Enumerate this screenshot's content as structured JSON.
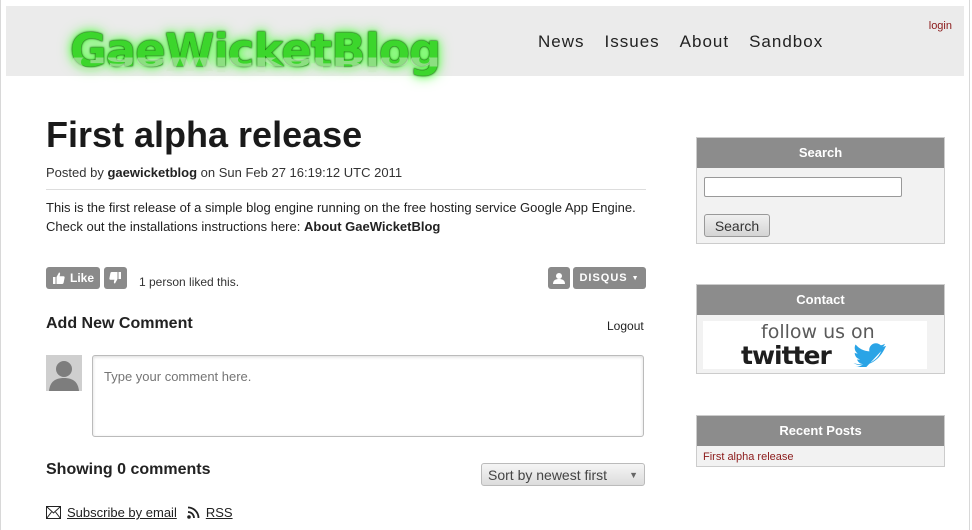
{
  "header": {
    "login": "login",
    "logo": "GaeWicketBlog",
    "nav": [
      "News",
      "Issues",
      "About",
      "Sandbox"
    ]
  },
  "post": {
    "title": "First alpha release",
    "posted_by_prefix": "Posted by",
    "author": "gaewicketblog",
    "date_text": "on Sun Feb 27 16:19:12 UTC 2011",
    "body_line1": "This is the first release of a simple blog engine running on the free hosting service Google App Engine.",
    "body_line2_prefix": "Check out the installations instructions here:",
    "body_link": "About GaeWicketBlog"
  },
  "comments": {
    "like_label": "Like",
    "liked_text": "1 person liked this.",
    "disqus_label": "DISQUS",
    "add_comment_heading": "Add New Comment",
    "logout": "Logout",
    "comment_placeholder": "Type your comment here.",
    "showing": "Showing 0 comments",
    "sort_selected": "Sort by newest first",
    "subscribe_email": "Subscribe by email",
    "rss": "RSS"
  },
  "sidebar": {
    "search_title": "Search",
    "search_button": "Search",
    "contact_title": "Contact",
    "twitter_follow": "follow us on",
    "twitter_brand": "twitter",
    "recent_title": "Recent Posts",
    "recent_posts": [
      "First alpha release"
    ]
  },
  "colors": {
    "accent_link": "#8b1a1a",
    "logo_green": "#3cd62c",
    "box_header": "#8c8c8c",
    "twitter_blue": "#1da1f2"
  }
}
